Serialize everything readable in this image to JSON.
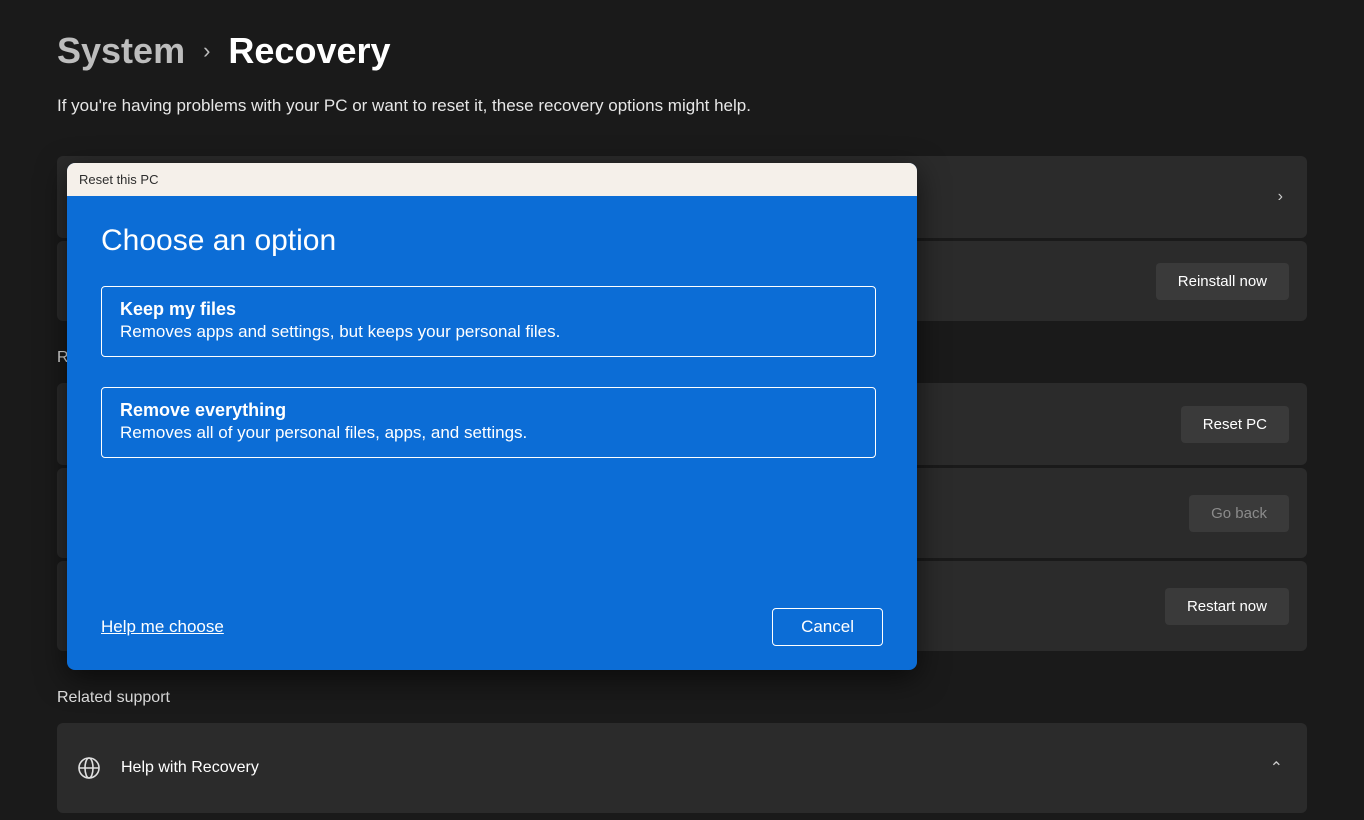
{
  "breadcrumb": {
    "root": "System",
    "current": "Recovery"
  },
  "subtitle": "If you're having problems with your PC or want to reset it, these recovery options might help.",
  "cards": {
    "reinstall": {
      "button": "Reinstall now"
    },
    "reset": {
      "button": "Reset PC"
    },
    "goback": {
      "button": "Go back"
    },
    "restart": {
      "button": "Restart now"
    }
  },
  "section_label_char": "R",
  "related": {
    "label": "Related support",
    "help_recovery": "Help with Recovery"
  },
  "modal": {
    "titlebar": "Reset this PC",
    "heading": "Choose an option",
    "options": [
      {
        "title": "Keep my files",
        "desc": "Removes apps and settings, but keeps your personal files."
      },
      {
        "title": "Remove everything",
        "desc": "Removes all of your personal files, apps, and settings."
      }
    ],
    "help_link": "Help me choose",
    "cancel": "Cancel"
  }
}
